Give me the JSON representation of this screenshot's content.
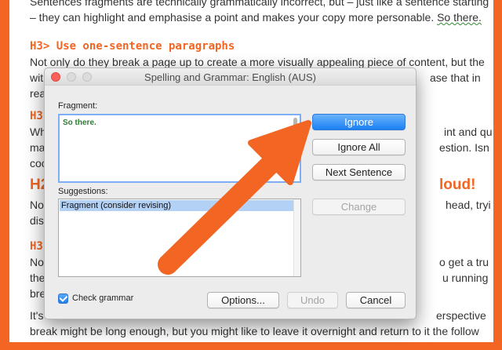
{
  "document": {
    "line1": "Sentences fragments are technically grammatically incorrect, but – just like a sentence starting",
    "line2_pre": "– they can highlight and emphasise a point and makes your copy more personable. ",
    "line2_mark": "So there.",
    "heading1": "H3> Use one-sentence paragraphs",
    "line4_left": "Not only do they break a page up to create a more visually appealing piece of content, but the",
    "line5_left": "wit",
    "line5_right": "ase that in",
    "line6_left": "rea",
    "heading2_left": "H3",
    "line8_left": "Wh",
    "line8_right": "int and qu",
    "line9_left": "ma",
    "line9_right": "estion. Isn",
    "line10_left": "coo",
    "heading3_left": "H2",
    "heading3_right": "loud!",
    "line12_left": "No",
    "line12_right": "head, tryi",
    "line13_left": "dist",
    "heading4_left": "H3",
    "line15_left": "No",
    "line15_right": "o get a tru",
    "line16_left": "the",
    "line16_right": "u running",
    "line17_left": "bre",
    "line18_left": "It's",
    "line18_right": "erspective",
    "line19": "break might be long enough, but you might like to leave it overnight and return to it the follow"
  },
  "dialog": {
    "title": "Spelling and Grammar: English (AUS)",
    "fragment_label": "Fragment:",
    "fragment_text": "So there.",
    "suggestions_label": "Suggestions:",
    "suggestions": [
      "Fragment (consider revising)"
    ],
    "check_grammar_label": "Check grammar",
    "check_grammar_checked": true,
    "buttons": {
      "ignore": "Ignore",
      "ignore_all": "Ignore All",
      "next_sentence": "Next Sentence",
      "change": "Change",
      "options": "Options...",
      "undo": "Undo",
      "cancel": "Cancel"
    }
  },
  "colors": {
    "accent_orange": "#f26522",
    "primary_blue": "#1b80f4",
    "fragment_green": "#2e7d32"
  },
  "icons": {
    "annotation": "arrow-pointer-icon",
    "checkbox": "checkmark-icon"
  }
}
